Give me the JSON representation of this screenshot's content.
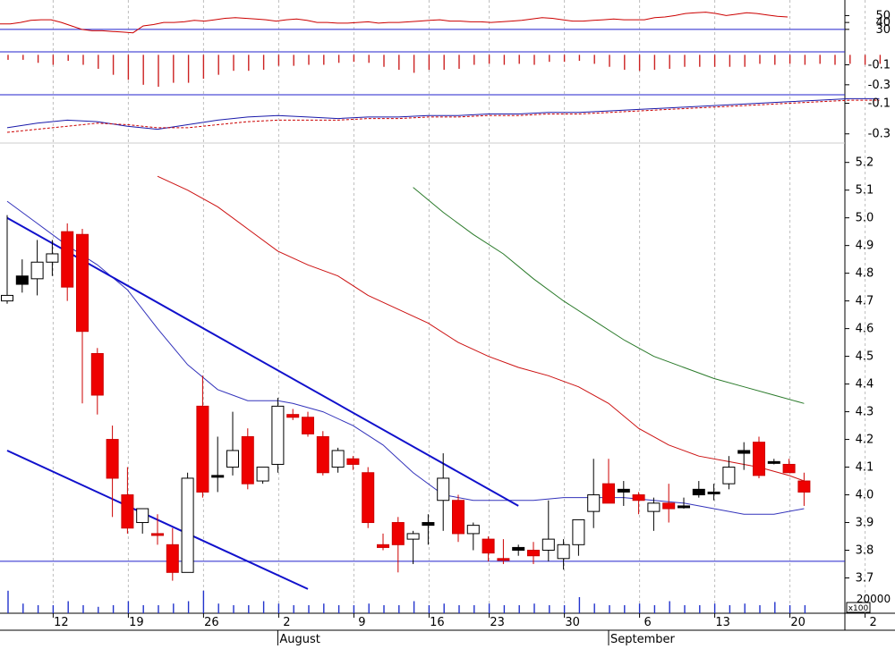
{
  "chart_data": [
    {
      "type": "line",
      "panel": "oscillator",
      "y_ticks": [
        "50",
        "40",
        "30"
      ],
      "ylim": [
        0,
        70
      ],
      "reference_levels": [
        30
      ],
      "series": [
        {
          "color": "#cc0000",
          "values": [
            38,
            38,
            40,
            43,
            44,
            44,
            40,
            35,
            30,
            28,
            28,
            27,
            26,
            25,
            35,
            37,
            40,
            40,
            41,
            43,
            42,
            44,
            46,
            47,
            46,
            45,
            44,
            42,
            44,
            45,
            43,
            40,
            40,
            39,
            39,
            40,
            41,
            39,
            40,
            40,
            41,
            42,
            43,
            44,
            42,
            42,
            41,
            41,
            40,
            41,
            42,
            43,
            45,
            47,
            46,
            44,
            42,
            42,
            43,
            44,
            45,
            44,
            44,
            44,
            47,
            48,
            50,
            53,
            54,
            55,
            53,
            50,
            52,
            54,
            53,
            51,
            49,
            48
          ]
        }
      ]
    },
    {
      "type": "bar",
      "panel": "histogram",
      "y_ticks": [
        "-0.1",
        "-0.3"
      ],
      "ylim": [
        -0.4,
        0.03
      ],
      "values": [
        -0.05,
        -0.05,
        -0.08,
        -0.1,
        -0.06,
        -0.1,
        -0.14,
        -0.2,
        -0.25,
        -0.3,
        -0.32,
        -0.28,
        -0.28,
        -0.24,
        -0.2,
        -0.16,
        -0.16,
        -0.15,
        -0.11,
        -0.11,
        -0.1,
        -0.1,
        -0.08,
        -0.07,
        -0.08,
        -0.12,
        -0.15,
        -0.18,
        -0.15,
        -0.15,
        -0.14,
        -0.1,
        -0.09,
        -0.1,
        -0.09,
        -0.1,
        -0.07,
        -0.07,
        -0.06,
        -0.09,
        -0.12,
        -0.15,
        -0.16,
        -0.15,
        -0.14,
        -0.12,
        -0.12,
        -0.12,
        -0.12,
        -0.12,
        -0.09,
        -0.1,
        -0.09,
        -0.1,
        -0.09,
        -0.1,
        -0.09,
        -0.1,
        -0.09
      ]
    },
    {
      "type": "line",
      "panel": "macd",
      "y_ticks": [
        "-0.1",
        "-0.3"
      ],
      "ylim": [
        -0.36,
        -0.05
      ],
      "series": [
        {
          "color": "#1a1aaa",
          "style": "solid",
          "x": [
            0,
            2,
            4,
            6,
            8,
            10,
            12,
            14,
            16,
            18,
            20,
            22,
            24,
            26,
            28,
            30,
            32,
            34,
            36,
            38,
            40,
            42,
            44,
            46,
            48,
            50,
            52,
            54,
            56,
            58
          ],
          "values": [
            -0.26,
            -0.23,
            -0.21,
            -0.22,
            -0.25,
            -0.27,
            -0.24,
            -0.21,
            -0.19,
            -0.18,
            -0.19,
            -0.2,
            -0.19,
            -0.19,
            -0.18,
            -0.18,
            -0.17,
            -0.17,
            -0.16,
            -0.16,
            -0.15,
            -0.14,
            -0.13,
            -0.12,
            -0.11,
            -0.1,
            -0.09,
            -0.08,
            -0.07,
            -0.07
          ]
        },
        {
          "color": "#cc0000",
          "style": "dashed",
          "x": [
            0,
            2,
            4,
            6,
            8,
            10,
            12,
            14,
            16,
            18,
            20,
            22,
            24,
            26,
            28,
            30,
            32,
            34,
            36,
            38,
            40,
            42,
            44,
            46,
            48,
            50,
            52,
            54,
            56,
            58
          ],
          "values": [
            -0.29,
            -0.27,
            -0.25,
            -0.23,
            -0.24,
            -0.26,
            -0.26,
            -0.24,
            -0.22,
            -0.21,
            -0.21,
            -0.21,
            -0.2,
            -0.2,
            -0.19,
            -0.19,
            -0.18,
            -0.18,
            -0.17,
            -0.17,
            -0.16,
            -0.15,
            -0.14,
            -0.13,
            -0.12,
            -0.11,
            -0.1,
            -0.09,
            -0.08,
            -0.08
          ]
        }
      ]
    },
    {
      "type": "candlestick",
      "panel": "price",
      "y_ticks": [
        "5.2",
        "5.1",
        "5.0",
        "4.9",
        "4.8",
        "4.7",
        "4.6",
        "4.5",
        "4.4",
        "4.3",
        "4.2",
        "4.1",
        "4.0",
        "3.9",
        "3.8",
        "3.7"
      ],
      "ylim": [
        3.65,
        5.27
      ],
      "x_ticks": [
        "12",
        "19",
        "26",
        "2",
        "9",
        "16",
        "23",
        "30",
        "6",
        "13",
        "20",
        "2"
      ],
      "x_tick_index": [
        3,
        8,
        13,
        18,
        23,
        28,
        32,
        37,
        42,
        47,
        52,
        57
      ],
      "months": [
        "August",
        "September"
      ],
      "month_index": [
        18,
        40
      ],
      "candles": [
        {
          "o": 4.7,
          "h": 5.01,
          "l": 4.69,
          "c": 4.72,
          "t": "w"
        },
        {
          "o": 4.79,
          "h": 4.85,
          "l": 4.73,
          "c": 4.76,
          "t": "b"
        },
        {
          "o": 4.78,
          "h": 4.92,
          "l": 4.72,
          "c": 4.84,
          "t": "w"
        },
        {
          "o": 4.84,
          "h": 4.92,
          "l": 4.79,
          "c": 4.87,
          "t": "w"
        },
        {
          "o": 4.95,
          "h": 4.98,
          "l": 4.7,
          "c": 4.75,
          "t": "r"
        },
        {
          "o": 4.94,
          "h": 4.96,
          "l": 4.33,
          "c": 4.59,
          "t": "r"
        },
        {
          "o": 4.51,
          "h": 4.53,
          "l": 4.29,
          "c": 4.36,
          "t": "r"
        },
        {
          "o": 4.2,
          "h": 4.25,
          "l": 3.92,
          "c": 4.06,
          "t": "r"
        },
        {
          "o": 4.0,
          "h": 4.1,
          "l": 3.86,
          "c": 3.88,
          "t": "r"
        },
        {
          "o": 3.9,
          "h": 3.95,
          "l": 3.86,
          "c": 3.95,
          "t": "w"
        },
        {
          "o": 3.86,
          "h": 3.93,
          "l": 3.82,
          "c": 3.86,
          "t": "r"
        },
        {
          "o": 3.82,
          "h": 3.88,
          "l": 3.69,
          "c": 3.72,
          "t": "r"
        },
        {
          "o": 3.72,
          "h": 4.08,
          "l": 3.72,
          "c": 4.06,
          "t": "w"
        },
        {
          "o": 4.32,
          "h": 4.43,
          "l": 3.99,
          "c": 4.01,
          "t": "r"
        },
        {
          "o": 4.07,
          "h": 4.21,
          "l": 4.01,
          "c": 4.07,
          "t": "b"
        },
        {
          "o": 4.1,
          "h": 4.3,
          "l": 4.07,
          "c": 4.16,
          "t": "w"
        },
        {
          "o": 4.21,
          "h": 4.24,
          "l": 4.02,
          "c": 4.04,
          "t": "r"
        },
        {
          "o": 4.05,
          "h": 4.1,
          "l": 4.04,
          "c": 4.1,
          "t": "w"
        },
        {
          "o": 4.11,
          "h": 4.35,
          "l": 4.08,
          "c": 4.32,
          "t": "w"
        },
        {
          "o": 4.29,
          "h": 4.31,
          "l": 4.27,
          "c": 4.28,
          "t": "r"
        },
        {
          "o": 4.28,
          "h": 4.3,
          "l": 4.21,
          "c": 4.22,
          "t": "r"
        },
        {
          "o": 4.21,
          "h": 4.23,
          "l": 4.07,
          "c": 4.08,
          "t": "r"
        },
        {
          "o": 4.1,
          "h": 4.17,
          "l": 4.08,
          "c": 4.16,
          "t": "w"
        },
        {
          "o": 4.13,
          "h": 4.14,
          "l": 4.09,
          "c": 4.11,
          "t": "r"
        },
        {
          "o": 4.08,
          "h": 4.1,
          "l": 3.88,
          "c": 3.9,
          "t": "r"
        },
        {
          "o": 3.81,
          "h": 3.86,
          "l": 3.8,
          "c": 3.82,
          "t": "r"
        },
        {
          "o": 3.9,
          "h": 3.92,
          "l": 3.72,
          "c": 3.82,
          "t": "r"
        },
        {
          "o": 3.84,
          "h": 3.87,
          "l": 3.75,
          "c": 3.86,
          "t": "w"
        },
        {
          "o": 3.89,
          "h": 3.93,
          "l": 3.82,
          "c": 3.9,
          "t": "b"
        },
        {
          "o": 3.98,
          "h": 4.15,
          "l": 3.87,
          "c": 4.06,
          "t": "w"
        },
        {
          "o": 3.98,
          "h": 4.0,
          "l": 3.83,
          "c": 3.86,
          "t": "r"
        },
        {
          "o": 3.86,
          "h": 3.9,
          "l": 3.8,
          "c": 3.89,
          "t": "w"
        },
        {
          "o": 3.84,
          "h": 3.85,
          "l": 3.76,
          "c": 3.79,
          "t": "r"
        },
        {
          "o": 3.77,
          "h": 3.84,
          "l": 3.75,
          "c": 3.77,
          "t": "r"
        },
        {
          "o": 3.8,
          "h": 3.82,
          "l": 3.78,
          "c": 3.81,
          "t": "b"
        },
        {
          "o": 3.8,
          "h": 3.83,
          "l": 3.75,
          "c": 3.78,
          "t": "r"
        },
        {
          "o": 3.8,
          "h": 3.98,
          "l": 3.76,
          "c": 3.84,
          "t": "w"
        },
        {
          "o": 3.77,
          "h": 3.84,
          "l": 3.73,
          "c": 3.82,
          "t": "w"
        },
        {
          "o": 3.82,
          "h": 3.9,
          "l": 3.78,
          "c": 3.91,
          "t": "w"
        },
        {
          "o": 3.94,
          "h": 4.13,
          "l": 3.88,
          "c": 4.0,
          "t": "w"
        },
        {
          "o": 4.04,
          "h": 4.13,
          "l": 3.98,
          "c": 3.97,
          "t": "r"
        },
        {
          "o": 4.02,
          "h": 4.05,
          "l": 3.96,
          "c": 4.01,
          "t": "b"
        },
        {
          "o": 4.0,
          "h": 4.01,
          "l": 3.93,
          "c": 3.98,
          "t": "r"
        },
        {
          "o": 3.97,
          "h": 3.99,
          "l": 3.87,
          "c": 3.94,
          "t": "w"
        },
        {
          "o": 3.97,
          "h": 4.04,
          "l": 3.9,
          "c": 3.95,
          "t": "r"
        },
        {
          "o": 3.96,
          "h": 3.99,
          "l": 3.95,
          "c": 3.96,
          "t": "b"
        },
        {
          "o": 4.02,
          "h": 4.05,
          "l": 3.99,
          "c": 4.0,
          "t": "b"
        },
        {
          "o": 4.01,
          "h": 4.04,
          "l": 3.98,
          "c": 4.01,
          "t": "b"
        },
        {
          "o": 4.04,
          "h": 4.14,
          "l": 4.02,
          "c": 4.1,
          "t": "w"
        },
        {
          "o": 4.16,
          "h": 4.19,
          "l": 4.09,
          "c": 4.15,
          "t": "b"
        },
        {
          "o": 4.19,
          "h": 4.21,
          "l": 4.06,
          "c": 4.07,
          "t": "r"
        },
        {
          "o": 4.12,
          "h": 4.13,
          "l": 4.11,
          "c": 4.12,
          "t": "b"
        },
        {
          "o": 4.11,
          "h": 4.13,
          "l": 4.08,
          "c": 4.08,
          "t": "r"
        },
        {
          "o": 4.05,
          "h": 4.08,
          "l": 3.96,
          "c": 4.01,
          "t": "r"
        }
      ],
      "overlays": [
        {
          "color": "#3333bb",
          "width": 1,
          "x": [
            0,
            2,
            4,
            6,
            8,
            10,
            12,
            14,
            16,
            18,
            19,
            21,
            23,
            25,
            27,
            29,
            31,
            33,
            35,
            37,
            39,
            41,
            43,
            45,
            47,
            49,
            51,
            53
          ],
          "values": [
            5.06,
            4.98,
            4.9,
            4.83,
            4.74,
            4.6,
            4.47,
            4.38,
            4.34,
            4.34,
            4.33,
            4.3,
            4.25,
            4.18,
            4.08,
            4.0,
            3.98,
            3.98,
            3.98,
            3.99,
            3.99,
            3.99,
            3.98,
            3.97,
            3.95,
            3.93,
            3.93,
            3.95
          ]
        },
        {
          "color": "#cc1111",
          "width": 1,
          "x": [
            10,
            12,
            14,
            16,
            18,
            20,
            22,
            24,
            26,
            28,
            30,
            32,
            34,
            36,
            38,
            40,
            42,
            44,
            46,
            48,
            50,
            52,
            53
          ],
          "values": [
            5.15,
            5.1,
            5.04,
            4.96,
            4.88,
            4.83,
            4.79,
            4.72,
            4.67,
            4.62,
            4.55,
            4.5,
            4.46,
            4.43,
            4.39,
            4.33,
            4.24,
            4.18,
            4.14,
            4.12,
            4.1,
            4.07,
            4.05
          ]
        },
        {
          "color": "#2a7a2a",
          "width": 1,
          "x": [
            27,
            29,
            31,
            33,
            35,
            37,
            39,
            41,
            43,
            45,
            47,
            49,
            51,
            53
          ],
          "values": [
            5.11,
            5.02,
            4.94,
            4.87,
            4.78,
            4.7,
            4.63,
            4.56,
            4.5,
            4.46,
            4.42,
            4.39,
            4.36,
            4.33
          ]
        },
        {
          "color": "#1111cc",
          "width": 2,
          "x": [
            0,
            34
          ],
          "values": [
            5.0,
            3.96
          ]
        },
        {
          "color": "#1111cc",
          "width": 2,
          "x": [
            0,
            20
          ],
          "values": [
            4.16,
            3.66
          ]
        }
      ],
      "reference_levels": [
        3.76
      ]
    },
    {
      "type": "bar",
      "panel": "volume",
      "y_ticks": [
        "20000"
      ],
      "y_unit": "x100",
      "values": [
        28,
        12,
        10,
        10,
        15,
        10,
        8,
        10,
        15,
        10,
        10,
        12,
        15,
        28,
        12,
        10,
        10,
        15,
        12,
        10,
        10,
        12,
        10,
        10,
        12,
        10,
        10,
        15,
        10,
        12,
        10,
        10,
        12,
        10,
        10,
        12,
        10,
        10,
        20,
        12,
        10,
        10,
        12,
        10,
        15,
        10,
        10,
        12,
        10,
        12,
        10,
        14,
        10,
        10
      ]
    }
  ]
}
